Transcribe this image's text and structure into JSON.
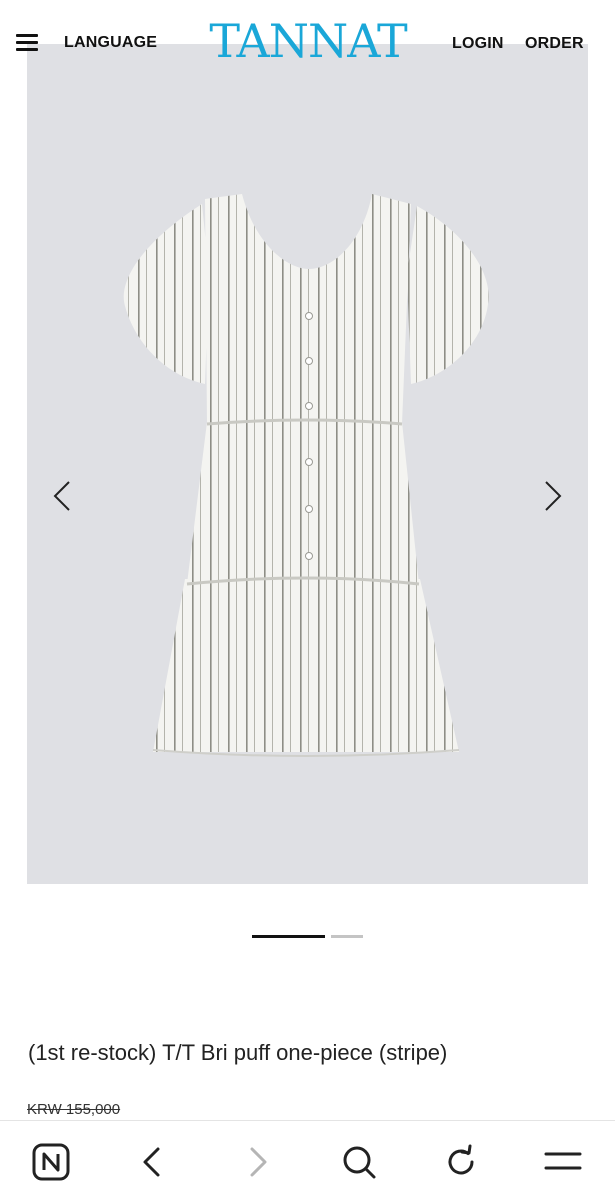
{
  "header": {
    "menu_icon": "hamburger-menu-icon",
    "language_label": "LANGUAGE",
    "logo_text": "TANNAT",
    "login_label": "LOGIN",
    "order_label": "ORDER",
    "logo_color": "#1aa7d8"
  },
  "gallery": {
    "image_subject": "striped puff-sleeve dress photo",
    "prev_icon": "chevron-left-icon",
    "next_icon": "chevron-right-icon",
    "slide_count": 2,
    "active_slide": 1
  },
  "product": {
    "title": "(1st re-stock) T/T Bri puff one-piece (stripe)",
    "original_price": "KRW 155,000"
  },
  "browser_bar": {
    "icons": [
      "naver-home-icon",
      "back-icon",
      "forward-icon",
      "search-icon",
      "refresh-icon",
      "menu-icon"
    ]
  },
  "colors": {
    "background": "#ffffff",
    "image_background": "#dfe0e4",
    "pagination_active": "#111111",
    "pagination_inactive": "#c4c4c4"
  }
}
